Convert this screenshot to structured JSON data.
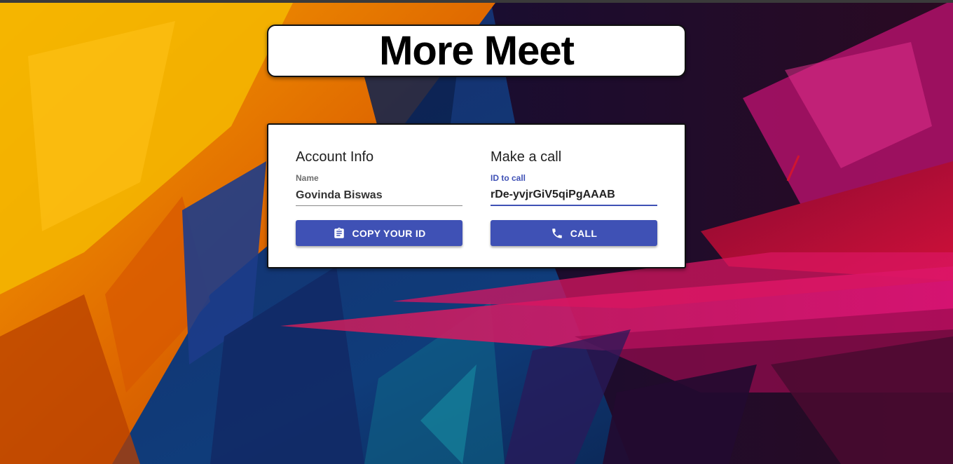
{
  "app": {
    "title": "More Meet"
  },
  "account": {
    "heading": "Account Info",
    "name_label": "Name",
    "name_value": "Govinda Biswas",
    "copy_button_label": "COPY YOUR ID",
    "copy_icon": "clipboard-icon"
  },
  "call": {
    "heading": "Make a call",
    "id_label": "ID to call",
    "id_value": "rDe-yvjrGiV5qiPgAAAB",
    "call_button_label": "CALL",
    "call_icon": "phone-icon"
  },
  "colors": {
    "primary": "#3f51b5",
    "card_background": "#ffffff"
  }
}
